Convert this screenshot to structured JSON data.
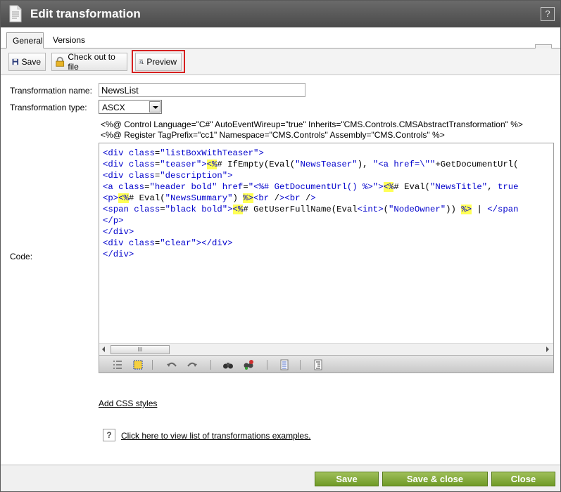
{
  "window": {
    "title": "Edit transformation",
    "help_label": "?"
  },
  "tabs": [
    {
      "label": "General",
      "active": true
    },
    {
      "label": "Versions",
      "active": false
    }
  ],
  "toolbar": {
    "save_label": "Save",
    "checkout_label": "Check out to file",
    "preview_label": "Preview"
  },
  "form": {
    "name_label": "Transformation name:",
    "name_value": "NewsList",
    "type_label": "Transformation type:",
    "type_value": "ASCX",
    "code_label": "Code:",
    "directive_1": "<%@ Control Language=\"C#\" AutoEventWireup=\"true\" Inherits=\"CMS.Controls.CMSAbstractTransformation\" %>",
    "directive_2": "<%@ Register TagPrefix=\"cc1\" Namespace=\"CMS.Controls\" Assembly=\"CMS.Controls\" %>"
  },
  "code_lines": [
    "<div class=\"listBoxWithTeaser\">",
    "<div class=\"teaser\"><%# IfEmpty(Eval(\"NewsTeaser\"), \"<a href=\\\"\"+GetDocumentUrl(",
    "<div class=\"description\">",
    "<a class=\"header bold\" href=\"<%# GetDocumentUrl() %>\"><%# Eval(\"NewsTitle\", true",
    "<p><%# Eval(\"NewsSummary\") %><br /><br />",
    "<span class=\"black bold\"><%# GetUserFullName(Eval<int>(\"NodeOwner\")) %> | </span",
    "</p>",
    "</div>",
    "<div class=\"clear\"></div>",
    "</div>"
  ],
  "editor": {
    "scroll_thumb": "III"
  },
  "links": {
    "css_styles": "Add CSS styles",
    "examples": "Click here to view list of transformations examples.",
    "examples_help": "?"
  },
  "footer": {
    "save_label": "Save",
    "save_close_label": "Save & close",
    "close_label": "Close"
  },
  "colors": {
    "accent_green": "#7fa83a",
    "highlight_red": "#d62020",
    "code_blue": "#0000cc",
    "code_highlight": "#ffff55"
  }
}
